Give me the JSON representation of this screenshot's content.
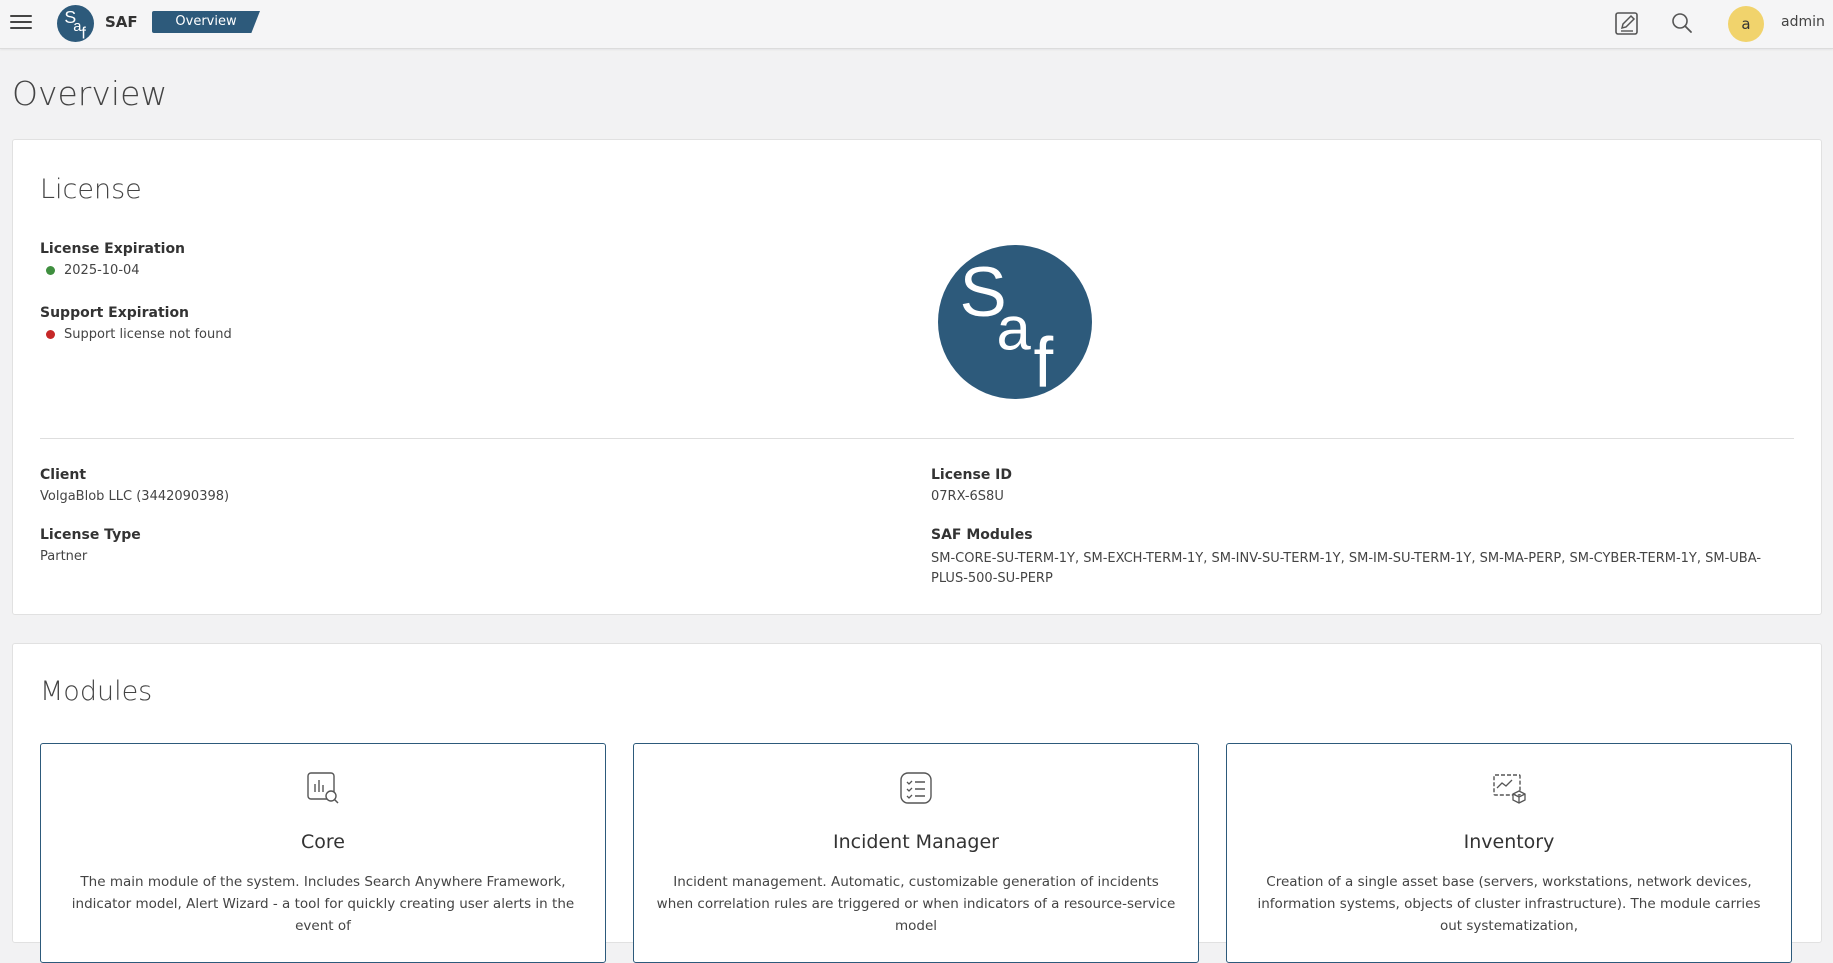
{
  "header": {
    "app_name": "SAF",
    "breadcrumb": "Overview",
    "avatar_initial": "a",
    "username": "admin",
    "icons": [
      "menu-icon",
      "edit-icon",
      "search-icon"
    ]
  },
  "logo": {
    "letters": [
      "S",
      "a",
      "f"
    ],
    "color": "#2d5a7b"
  },
  "page": {
    "title": "Overview"
  },
  "license": {
    "title": "License",
    "license_expiration_label": "License Expiration",
    "license_expiration_value": "2025-10-04",
    "license_expiration_status_color": "#3f8f3f",
    "support_expiration_label": "Support Expiration",
    "support_expiration_value": "Support license not found",
    "support_expiration_status_color": "#c62828",
    "client_label": "Client",
    "client_value": "VolgaBlob LLC (3442090398)",
    "license_type_label": "License Type",
    "license_type_value": "Partner",
    "license_id_label": "License ID",
    "license_id_value": "07RX-6S8U",
    "saf_modules_label": "SAF Modules",
    "saf_modules_value": "SM-CORE-SU-TERM-1Y, SM-EXCH-TERM-1Y, SM-INV-SU-TERM-1Y, SM-IM-SU-TERM-1Y, SM-MA-PERP, SM-CYBER-TERM-1Y, SM-UBA-PLUS-500-SU-PERP"
  },
  "modules": {
    "title": "Modules",
    "items": [
      {
        "title": "Core",
        "icon": "chart-search-icon",
        "description": "The main module of the system. Includes Search Anywhere Framework, indicator model, Alert Wizard - a tool for quickly creating user alerts in the event of"
      },
      {
        "title": "Incident Manager",
        "icon": "checklist-icon",
        "description": "Incident management. Automatic, customizable generation of incidents when correlation rules are triggered or when indicators of a resource-service model"
      },
      {
        "title": "Inventory",
        "icon": "inventory-icon",
        "description": "Creation of a single asset base (servers, workstations, network devices, information systems, objects of cluster infrastructure). The module carries out systematization,"
      }
    ]
  }
}
